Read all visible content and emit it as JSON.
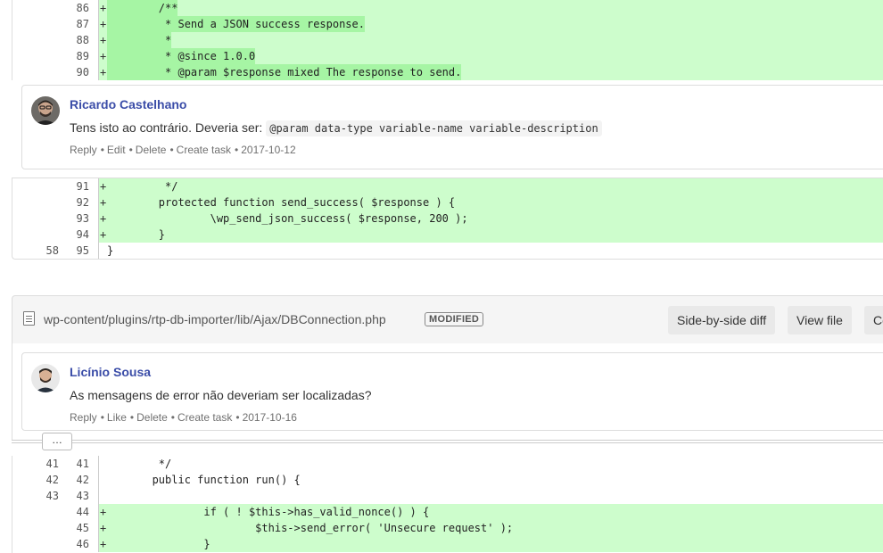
{
  "diff1": {
    "rows_top": [
      {
        "old": "",
        "new": "86",
        "mark": "+",
        "text": "        /**",
        "added": true,
        "hl": true
      },
      {
        "old": "",
        "new": "87",
        "mark": "+",
        "text": "         * Send a JSON success response.",
        "added": true,
        "hl": true
      },
      {
        "old": "",
        "new": "88",
        "mark": "+",
        "text": "         *",
        "added": true,
        "hl": true
      },
      {
        "old": "",
        "new": "89",
        "mark": "+",
        "text": "         * @since 1.0.0",
        "added": true,
        "hl": true
      },
      {
        "old": "",
        "new": "90",
        "mark": "+",
        "text": "         * @param $response mixed The response to send.",
        "added": true,
        "hl": true
      }
    ],
    "rows_bottom": [
      {
        "old": "",
        "new": "91",
        "mark": "+",
        "text": "         */",
        "added": true
      },
      {
        "old": "",
        "new": "92",
        "mark": "+",
        "text": "        protected function send_success( $response ) {",
        "added": true
      },
      {
        "old": "",
        "new": "93",
        "mark": "+",
        "text": "                \\wp_send_json_success( $response, 200 );",
        "added": true
      },
      {
        "old": "",
        "new": "94",
        "mark": "+",
        "text": "        }",
        "added": true
      },
      {
        "old": "58",
        "new": "95",
        "mark": "",
        "text": "}",
        "added": false
      }
    ]
  },
  "comment1": {
    "author": "Ricardo Castelhano",
    "text": "Tens isto ao contrário. Deveria ser: ",
    "code": "@param data-type variable-name variable-description",
    "actions": [
      "Reply",
      "Edit",
      "Delete",
      "Create task"
    ],
    "date": "2017-10-12"
  },
  "file": {
    "path": "wp-content/plugins/rtp-db-importer/lib/Ajax/DBConnection.php",
    "badge": "MODIFIED",
    "buttons": [
      "Side-by-side diff",
      "View file",
      "Co"
    ]
  },
  "comment2": {
    "author": "Licínio Sousa",
    "text": "As mensagens de error não deveriam ser localizadas?",
    "actions": [
      "Reply",
      "Like",
      "Delete",
      "Create task"
    ],
    "date": "2017-10-16"
  },
  "expander_label": "…",
  "diff2": {
    "rows": [
      {
        "old": "41",
        "new": "41",
        "mark": "",
        "text": "        */",
        "added": false
      },
      {
        "old": "42",
        "new": "42",
        "mark": "",
        "text": "       public function run() {",
        "added": false
      },
      {
        "old": "43",
        "new": "43",
        "mark": "",
        "text": "",
        "added": false
      },
      {
        "old": "",
        "new": "44",
        "mark": "+",
        "text": "               if ( ! $this->has_valid_nonce() ) {",
        "added": true
      },
      {
        "old": "",
        "new": "45",
        "mark": "+",
        "text": "                       $this->send_error( 'Unsecure request' );",
        "added": true
      },
      {
        "old": "",
        "new": "46",
        "mark": "+",
        "text": "               }",
        "added": true
      }
    ]
  },
  "colors": {
    "added_bg": "#cdfdcc",
    "added_hl": "#a6f5a4",
    "author": "#3b4da8"
  }
}
